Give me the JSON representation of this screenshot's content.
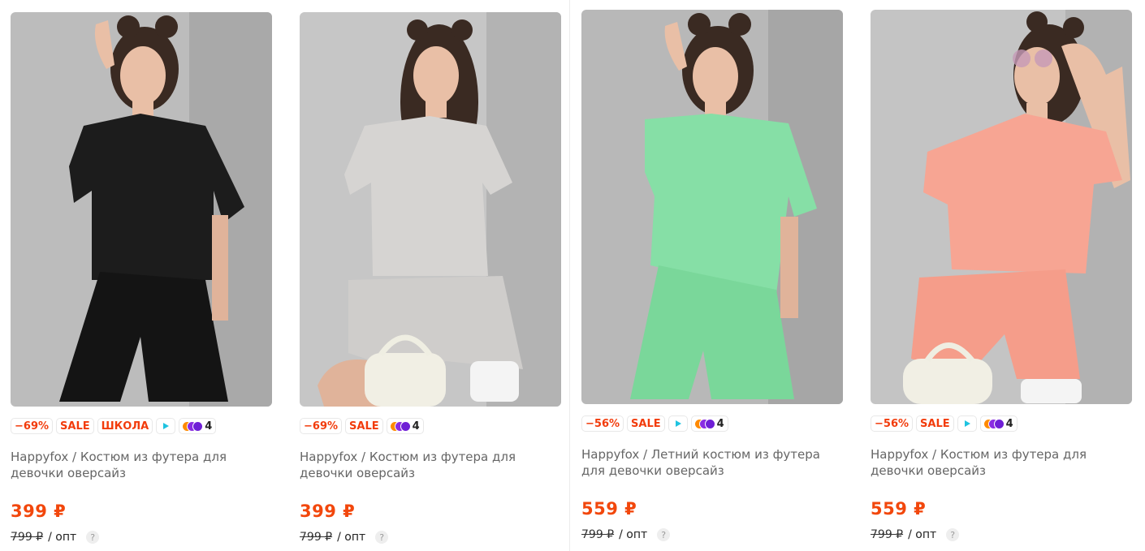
{
  "products": [
    {
      "discount": "−69%",
      "sale": "SALE",
      "extra": "ШКОЛА",
      "loyalty_count": "4",
      "title": "Happyfox / Костюм из футера для девочки оверсайз",
      "price": "399 ₽",
      "old_price": "799 ₽",
      "opt": "/ опт",
      "help": "?",
      "colors": {
        "bg": "#b9b9b9",
        "cloth": "#1c1c1c",
        "shorts": "#141414"
      }
    },
    {
      "discount": "−69%",
      "sale": "SALE",
      "loyalty_count": "4",
      "title": "Happyfox / Костюм из футера для девочки оверсайз",
      "price": "399 ₽",
      "old_price": "799 ₽",
      "opt": "/ опт",
      "help": "?",
      "colors": {
        "bg": "#c4c4c4",
        "cloth": "#d6d4d2",
        "shorts": "#cfcdcb"
      }
    },
    {
      "discount": "−56%",
      "sale": "SALE",
      "loyalty_count": "4",
      "title": "Happyfox / Летний костюм из футера для девочки оверсайз",
      "price": "559 ₽",
      "old_price": "799 ₽",
      "opt": "/ опт",
      "help": "?",
      "colors": {
        "bg": "#b5b5b5",
        "cloth": "#86dfa6",
        "shorts": "#7ad79a"
      }
    },
    {
      "discount": "−56%",
      "sale": "SALE",
      "loyalty_count": "4",
      "title": "Happyfox / Костюм из футера для девочки оверсайз",
      "price": "559 ₽",
      "old_price": "799 ₽",
      "opt": "/ опт",
      "help": "?",
      "colors": {
        "bg": "#c2c2c2",
        "cloth": "#f7a593",
        "shorts": "#f59d8a"
      }
    }
  ]
}
